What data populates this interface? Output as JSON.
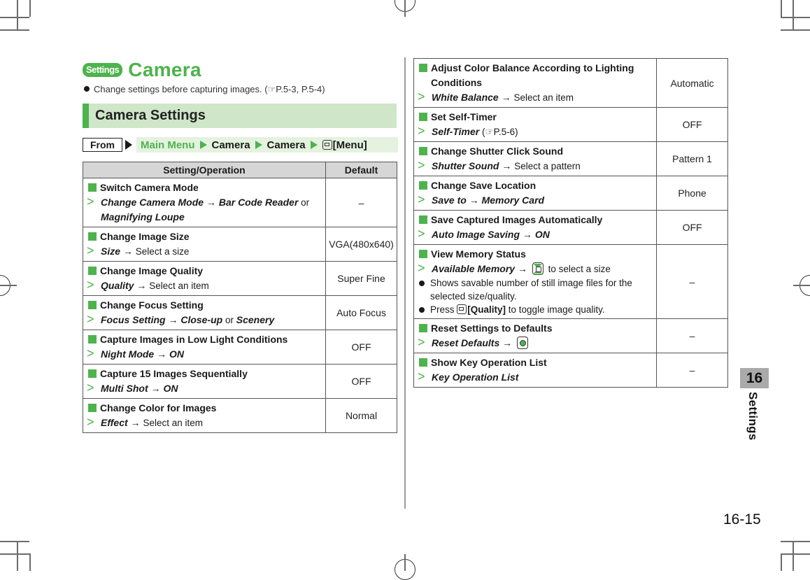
{
  "header": {
    "badge": "Settings",
    "title": "Camera",
    "intro": "Change settings before capturing images. (☞P.5-3, P.5-4)"
  },
  "section": {
    "title": "Camera Settings",
    "from_label": "From",
    "path": [
      "Main Menu",
      "Camera",
      "Camera",
      "[Menu]"
    ]
  },
  "table_headers": {
    "operation": "Setting/Operation",
    "default": "Default"
  },
  "left_rows": [
    {
      "title": "Switch Camera Mode",
      "step_a": "Change Camera Mode",
      "arrow": " → ",
      "step_b": "Bar Code Reader",
      "join": " or ",
      "step_c": "Magnifying Loupe",
      "default": "–"
    },
    {
      "title": "Change Image Size",
      "step_a": "Size",
      "arrow": " → ",
      "plain": "Select a size",
      "default": "VGA(480x640)"
    },
    {
      "title": "Change Image Quality",
      "step_a": "Quality",
      "arrow": " → ",
      "plain": "Select an item",
      "default": "Super Fine"
    },
    {
      "title": "Change Focus Setting",
      "step_a": "Focus Setting",
      "arrow": " → ",
      "step_b": "Close-up",
      "join": " or ",
      "step_c": "Scenery",
      "default": "Auto Focus"
    },
    {
      "title": "Capture Images in Low Light Conditions",
      "step_a": "Night Mode",
      "arrow": " → ",
      "step_b": "ON",
      "default": "OFF"
    },
    {
      "title": "Capture 15 Images Sequentially",
      "step_a": "Multi Shot",
      "arrow": " → ",
      "step_b": "ON",
      "default": "OFF"
    },
    {
      "title": "Change Color for Images",
      "step_a": "Effect",
      "arrow": " → ",
      "plain": "Select an item",
      "default": "Normal"
    }
  ],
  "right_rows": [
    {
      "title": "Adjust Color Balance According to Lighting Conditions",
      "step_a": "White Balance",
      "arrow": " → ",
      "plain": "Select an item",
      "default": "Automatic"
    },
    {
      "title": "Set Self-Timer",
      "step_a": "Self-Timer",
      "plain": " (☞P.5-6)",
      "default": "OFF"
    },
    {
      "title": "Change Shutter Click Sound",
      "step_a": "Shutter Sound",
      "arrow": " → ",
      "plain": "Select a pattern",
      "default": "Pattern 1"
    },
    {
      "title": "Change Save Location",
      "step_a": "Save to",
      "arrow": " → ",
      "step_b": "Memory Card",
      "default": "Phone"
    },
    {
      "title": "Save Captured Images Automatically",
      "step_a": "Auto Image Saving",
      "arrow": " → ",
      "step_b": "ON",
      "default": "OFF"
    },
    {
      "title": "View Memory Status",
      "step_a": "Available Memory",
      "arrow": " → ",
      "plain": " to select a size",
      "note1": "Shows savable number of still image files for the selected size/quality.",
      "note2_pre": "Press ",
      "note2_key": "[Quality]",
      "note2_post": " to toggle image quality.",
      "default": "–"
    },
    {
      "title": "Reset Settings to Defaults",
      "step_a": "Reset Defaults",
      "arrow": " → ",
      "default": "–"
    },
    {
      "title": "Show Key Operation List",
      "step_a": "Key Operation List",
      "default": "–"
    }
  ],
  "chapter": {
    "number": "16",
    "label": "Settings"
  },
  "page_number": "16-15",
  "colors": {
    "accent": "#4db34d",
    "section_bg": "#cfe6c8",
    "path_bg": "#e4f2df",
    "header_bg": "#d6d6d6"
  }
}
